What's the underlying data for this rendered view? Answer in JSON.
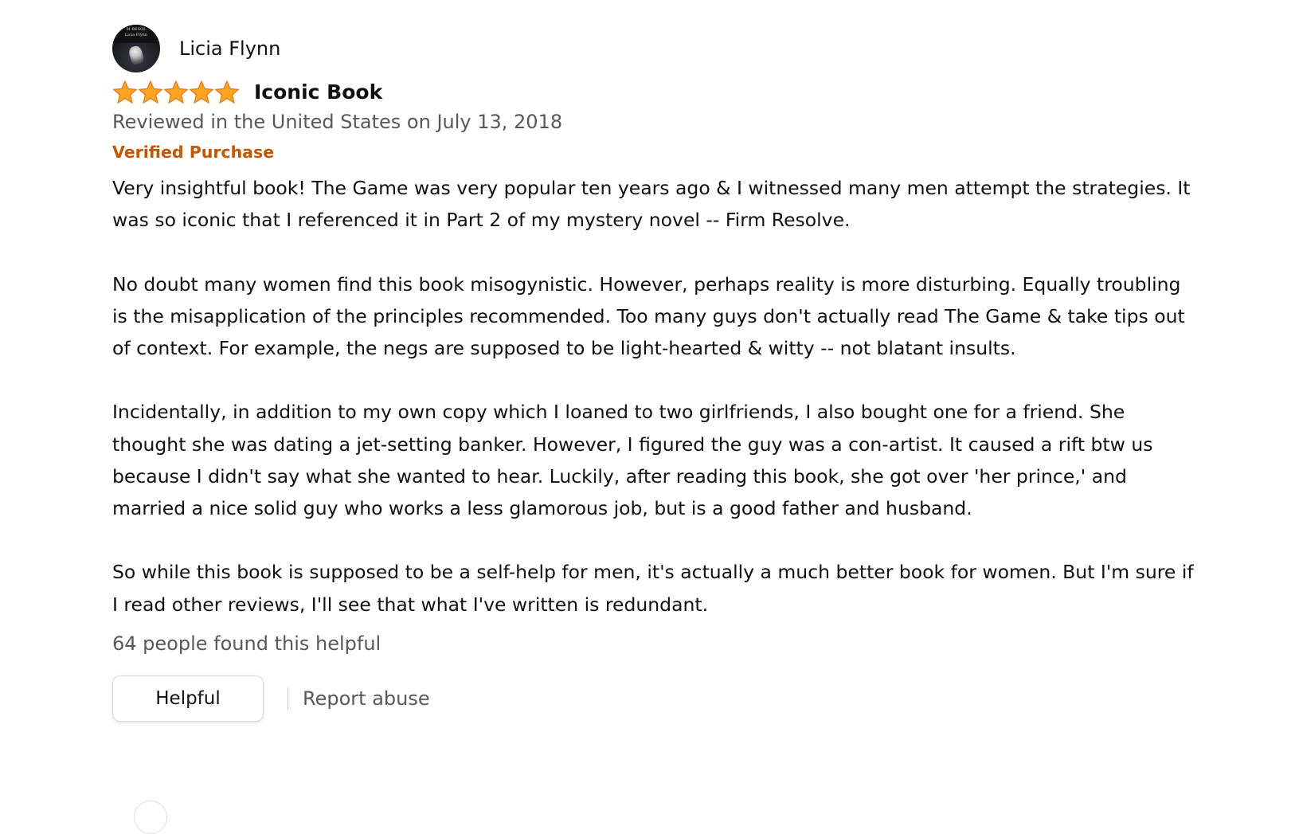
{
  "review": {
    "reviewer_name": "Licia Flynn",
    "avatar_text": "M RESOL\nLicia Flynn",
    "rating": 5,
    "rating_max": 5,
    "star_color": "#ffa41c",
    "star_outline": "#de7921",
    "title": "Iconic Book",
    "date_line": "Reviewed in the United States on July 13, 2018",
    "verified_label": "Verified Purchase",
    "verified_color": "#c45500",
    "body_paragraphs": [
      "Very insightful book! The Game was very popular ten years ago & I witnessed many men attempt the strategies. It was so iconic that I referenced it in Part 2 of my mystery novel -- Firm Resolve.",
      "No doubt many women find this book misogynistic. However, perhaps reality is more disturbing. Equally troubling is the misapplication of the principles recommended. Too many guys don't actually read The Game & take tips out of context. For example, the negs are supposed to be light-hearted & witty -- not blatant insults.",
      "Incidentally, in addition to my own copy which I loaned to two girlfriends, I also bought one for a friend. She thought she was dating a jet-setting banker. However, I figured the guy was a con-artist. It caused a rift btw us because I didn't say what she wanted to hear. Luckily, after reading this book, she got over 'her prince,' and married a nice solid guy who works a less glamorous job, but is a good father and husband.",
      "So while this book is supposed to be a self-help for men, it's actually a much better book for women. But I'm sure if I read other reviews, I'll see that what I've written is redundant."
    ],
    "helpful_count_text": "64 people found this helpful",
    "helpful_button_label": "Helpful",
    "report_label": "Report abuse"
  }
}
